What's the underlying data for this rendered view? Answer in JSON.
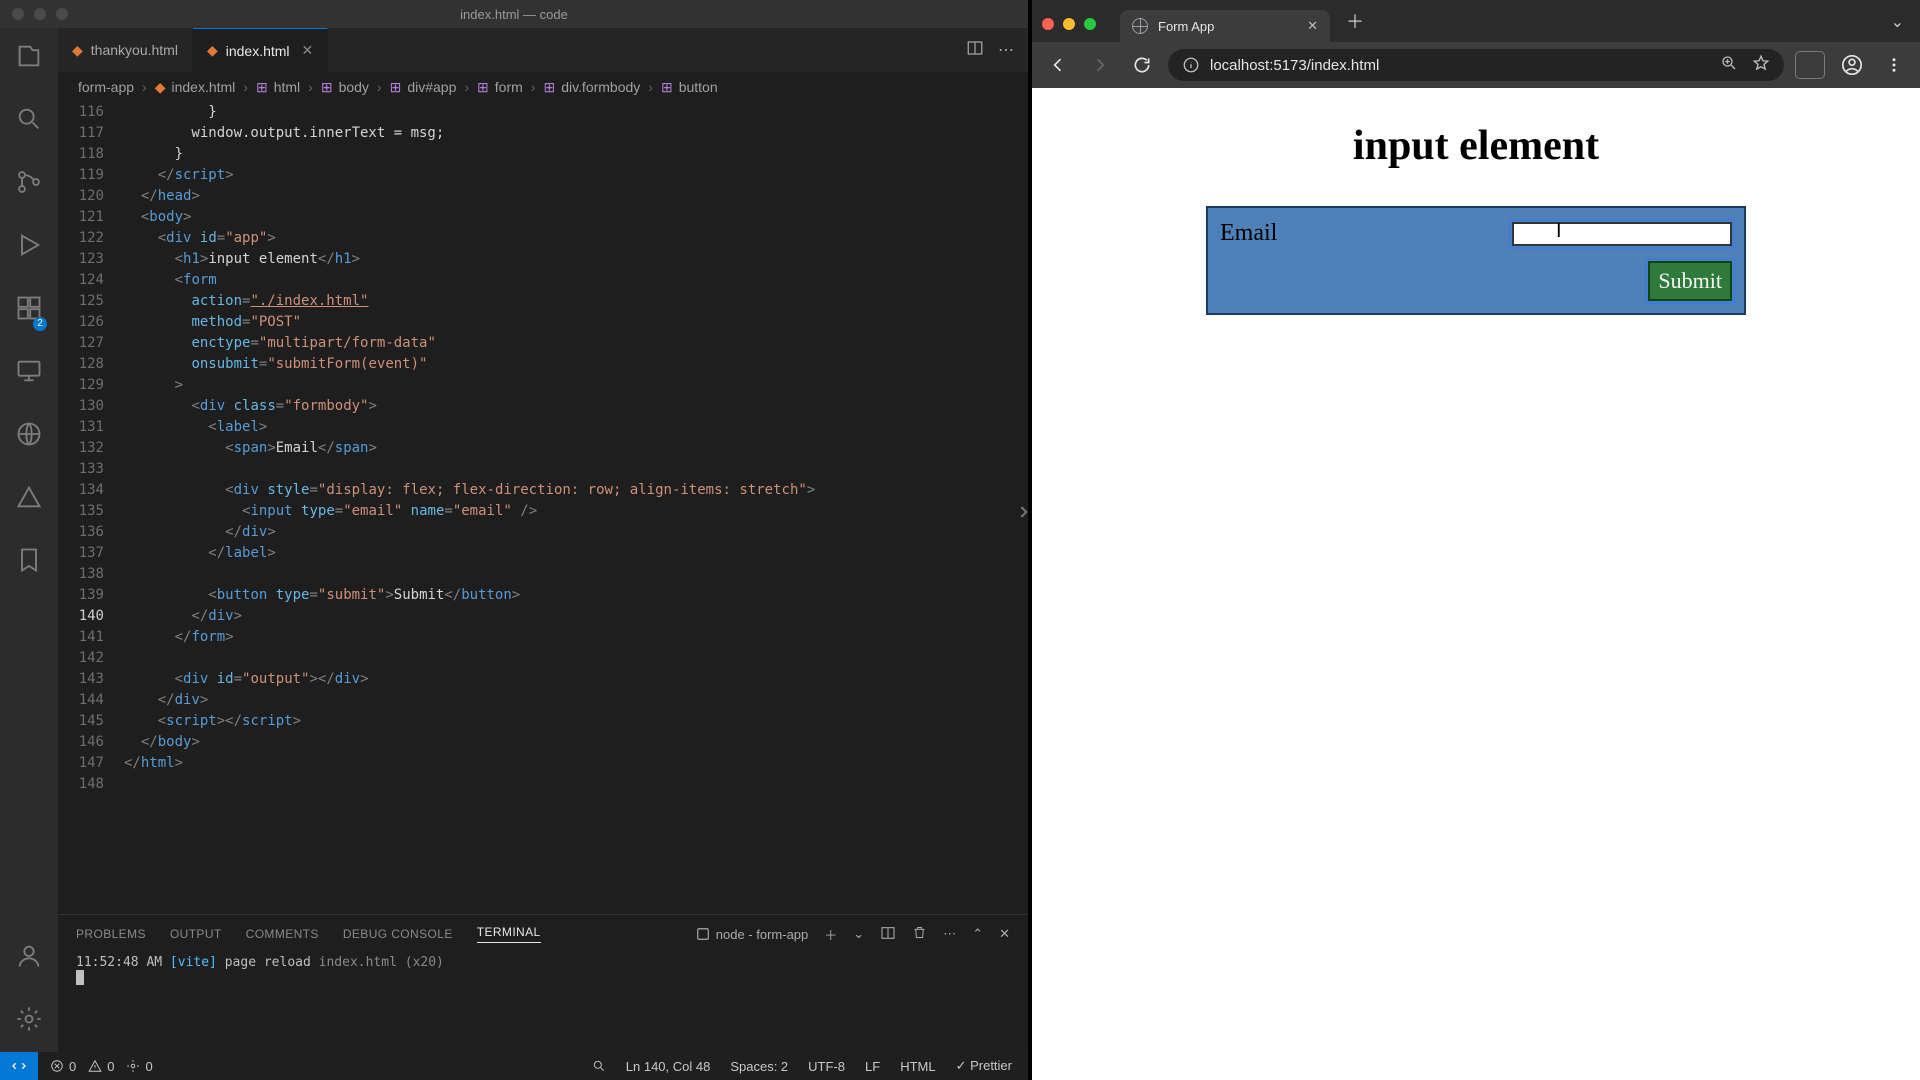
{
  "vscode": {
    "title": "index.html — code",
    "tabs": [
      {
        "label": "thankyou.html",
        "active": false
      },
      {
        "label": "index.html",
        "active": true
      }
    ],
    "breadcrumbs": [
      "form-app",
      "index.html",
      "html",
      "body",
      "div#app",
      "form",
      "div.formbody",
      "button"
    ],
    "activity_badge": "2",
    "gutter_start": 116,
    "highlighted_line": 140,
    "panel": {
      "tabs": [
        "PROBLEMS",
        "OUTPUT",
        "COMMENTS",
        "DEBUG CONSOLE",
        "TERMINAL"
      ],
      "active": "TERMINAL",
      "task": "node - form-app",
      "log_time": "11:52:48 AM",
      "log_tag": "[vite]",
      "log_msg": "page reload",
      "log_file": "index.html",
      "log_count": "(x20)"
    },
    "status": {
      "errors": "0",
      "warnings": "0",
      "ports": "0",
      "cursor": "Ln 140, Col 48",
      "spaces": "Spaces: 2",
      "encoding": "UTF-8",
      "eol": "LF",
      "lang": "HTML",
      "prettier": "Prettier"
    },
    "code": {
      "l116": "          }",
      "l117_pre": "        window.output.innerText = msg;",
      "l118": "      }",
      "l119_tag": "script",
      "l120_tag": "head",
      "l121_tag": "body",
      "l122_tag": "div",
      "l122_attr": "id",
      "l122_val": "\"app\"",
      "l123_tag": "h1",
      "l123_txt": "input element",
      "l124_tag": "form",
      "l125_attr": "action",
      "l125_val": "\"./index.html\"",
      "l126_attr": "method",
      "l126_val": "\"POST\"",
      "l127_attr": "enctype",
      "l127_val": "\"multipart/form-data\"",
      "l128_attr": "onsubmit",
      "l128_val": "\"submitForm(event)\"",
      "l130_tag": "div",
      "l130_attr": "class",
      "l130_val": "\"formbody\"",
      "l131_tag": "label",
      "l132_tag": "span",
      "l132_txt": "Email",
      "l134_tag": "div",
      "l134_attr": "style",
      "l134_val_a": "\"display: ",
      "l134_val_b": "flex",
      "l134_val_c": "; flex-direction: ",
      "l134_val_d": "row",
      "l134_val_e": "; align-items: ",
      "l134_val_f": "stretch",
      "l134_val_g": "\"",
      "l135_tag": "input",
      "l135_attr1": "type",
      "l135_val1": "\"email\"",
      "l135_attr2": "name",
      "l135_val2": "\"email\"",
      "l136_close": "div",
      "l137_close": "label",
      "l139_tag": "button",
      "l139_attr": "type",
      "l139_val": "\"submit\"",
      "l139_txt": "Submit",
      "l140_close": "div",
      "l141_close": "form",
      "l143_tag": "div",
      "l143_attr": "id",
      "l143_val": "\"output\"",
      "l144_close": "div",
      "l145_tag": "script",
      "l146_close": "body",
      "l147_close": "html"
    }
  },
  "chrome": {
    "tab_title": "Form App",
    "url": "localhost:5173/index.html"
  },
  "page": {
    "heading": "input element",
    "label": "Email",
    "input_value": "",
    "submit": "Submit"
  }
}
